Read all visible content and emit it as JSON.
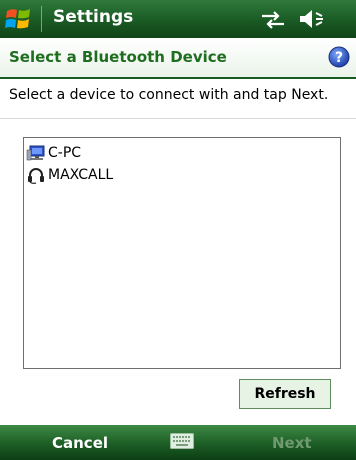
{
  "titlebar": {
    "title": "Settings",
    "icons": [
      "windows-flag-icon",
      "connectivity-icon",
      "volume-icon"
    ]
  },
  "header": {
    "title": "Select a Bluetooth Device",
    "help_icon": "help-icon"
  },
  "instructions": "Select a device to connect with and tap Next.",
  "devices": [
    {
      "label": "C-PC",
      "icon": "computer-icon"
    },
    {
      "label": "MAXCALL",
      "icon": "headset-icon"
    }
  ],
  "refresh_label": "Refresh",
  "softkeys": {
    "left": "Cancel",
    "right": "Next",
    "center_icon": "keyboard-icon"
  },
  "colors": {
    "title_bar": "#1a5a24",
    "header_text": "#1f6d1f",
    "button_bg": "#e7f3e5",
    "disabled_softkey": "#6f9a72"
  }
}
